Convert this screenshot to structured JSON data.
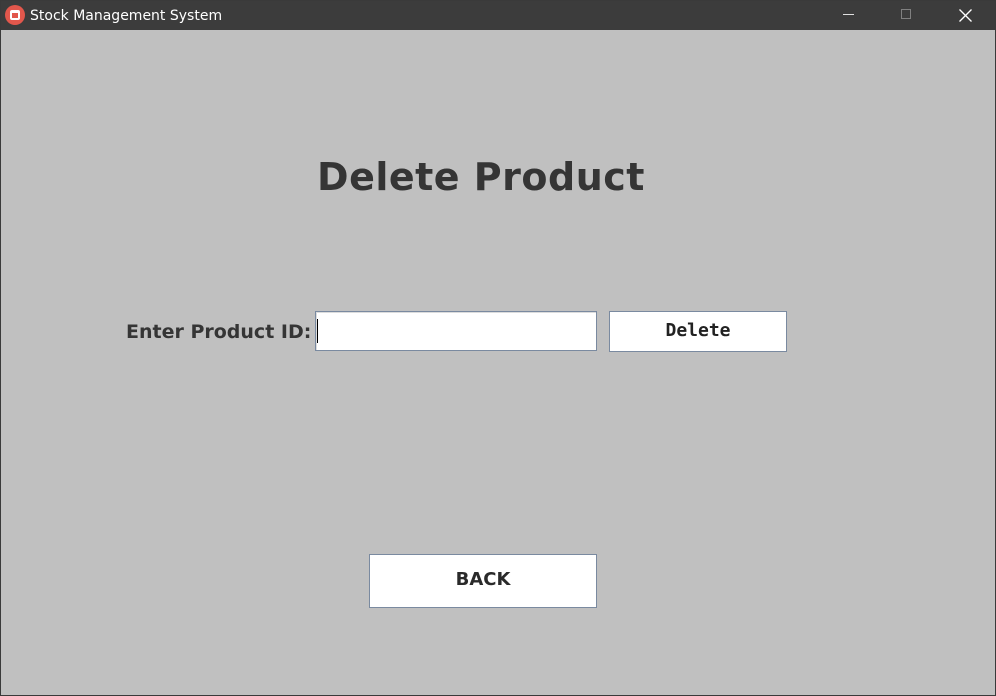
{
  "window": {
    "title": "Stock Management System",
    "controls": {
      "minimize_icon": "minimize-icon",
      "maximize_icon": "maximize-icon",
      "close_icon": "close-icon"
    }
  },
  "main": {
    "heading": "Delete Product",
    "product_id_label": "Enter Product ID:",
    "product_id_value": "",
    "delete_label": "Delete",
    "back_label": "BACK"
  },
  "colors": {
    "background": "#c0c0c0",
    "titlebar": "#3c3c3c",
    "app_icon": "#e2574c",
    "text": "#353535",
    "button_bg": "#ffffff"
  }
}
